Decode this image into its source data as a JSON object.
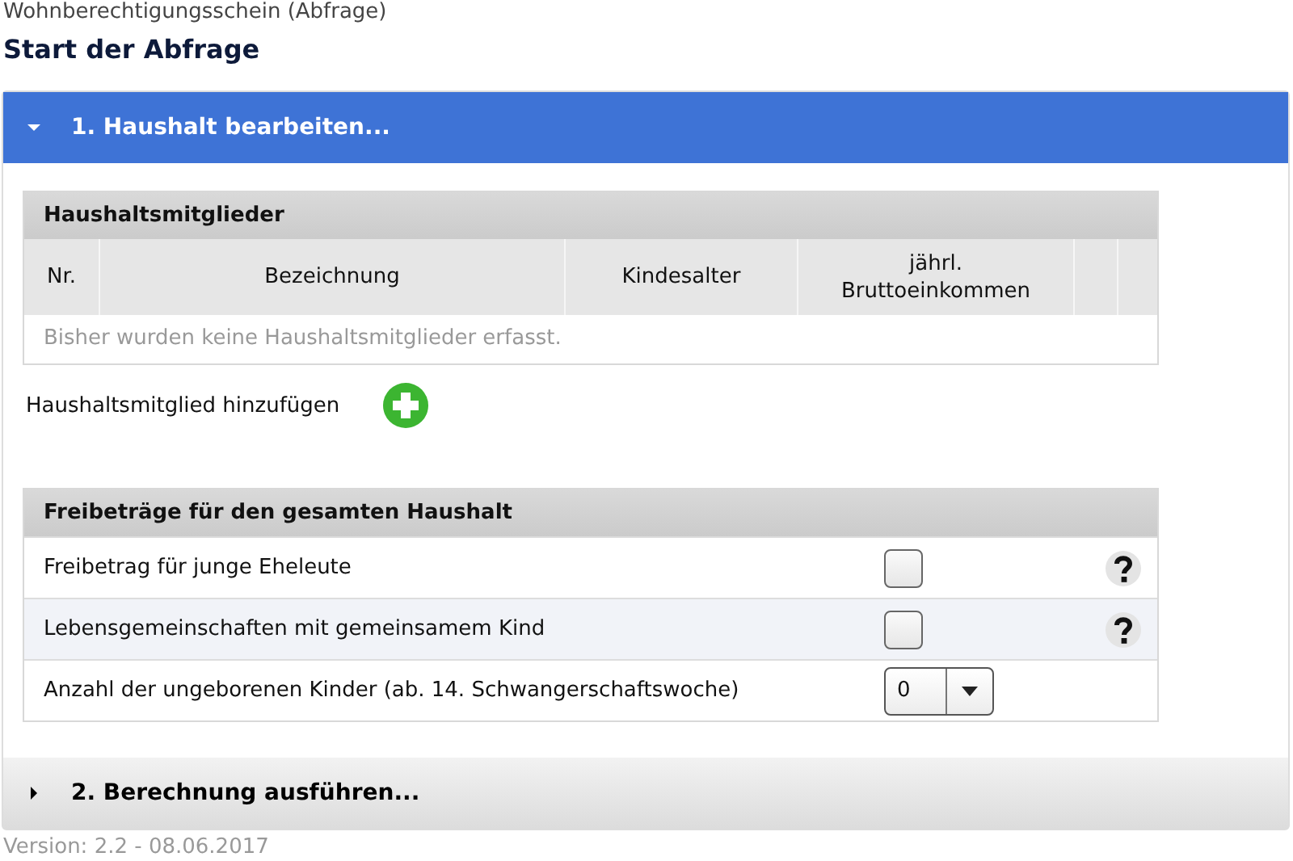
{
  "app_title": "Wohnberechtigungsschein (Abfrage)",
  "heading": "Start der Abfrage",
  "panels": [
    {
      "title": "1. Haushalt bearbeiten...",
      "expanded": true
    },
    {
      "title": "2. Berechnung ausführen...",
      "expanded": false
    }
  ],
  "members": {
    "title": "Haushaltsmitglieder",
    "columns": [
      "Nr.",
      "Bezeichnung",
      "Kindesalter",
      "jährl. Bruttoeinkommen"
    ],
    "empty_message": "Bisher wurden keine Haushaltsmitglieder erfasst."
  },
  "add_member": {
    "label": "Haushaltsmitglied hinzufügen"
  },
  "allowances": {
    "title": "Freibeträge für den gesamten Haushalt",
    "rows": [
      {
        "kind": "checkbox",
        "label": "Freibetrag für junge Eheleute",
        "checked": false
      },
      {
        "kind": "checkbox",
        "label": "Lebensgemeinschaften mit gemeinsamem Kind",
        "checked": false
      },
      {
        "kind": "select",
        "label": "Anzahl der ungeborenen Kinder (ab. 14. Schwangerschaftswoche)",
        "value": "0"
      }
    ]
  },
  "version": "Version: 2.2 - 08.06.2017"
}
